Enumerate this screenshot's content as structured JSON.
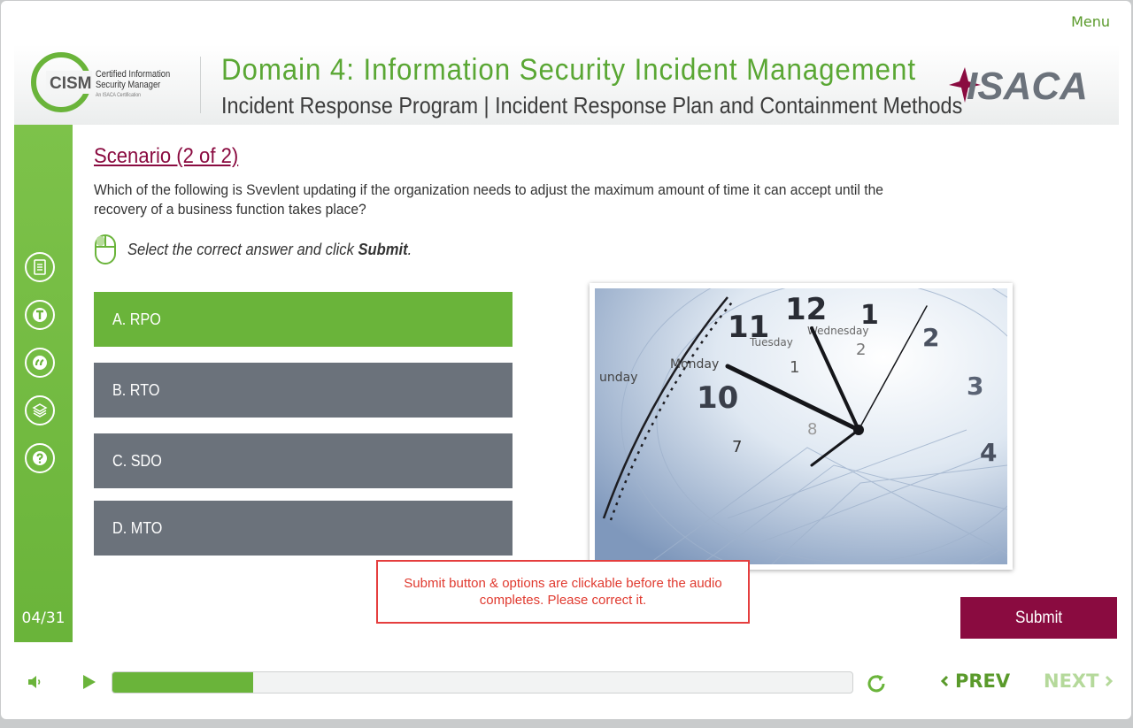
{
  "menu": {
    "label": "Menu"
  },
  "header": {
    "cism_mark": "CISM",
    "cism_line1": "Certified Information",
    "cism_line2": "Security Manager",
    "cism_tagline": "An ISACA Certification",
    "domain_title": "Domain 4: Information Security Incident Management",
    "subtitle": "Incident Response Program | Incident Response Plan and Containment Methods",
    "brand": "ISACA"
  },
  "sidebar": {
    "icons": [
      "notes-icon",
      "transcript-icon",
      "quote-icon",
      "layers-icon",
      "help-icon"
    ],
    "page": "04/31"
  },
  "question": {
    "heading": "Scenario (2 of 2)",
    "text": "Which of the following is Svevlent updating if the organization needs to adjust the maximum amount of time it can accept until the recovery of a business function takes place?",
    "instruction_prefix": "Select the correct answer and click ",
    "instruction_bold": "Submit",
    "instruction_suffix": "."
  },
  "options": [
    {
      "label": "A. RPO",
      "selected": true
    },
    {
      "label": "B. RTO",
      "selected": false
    },
    {
      "label": "C. SDO",
      "selected": false
    },
    {
      "label": "D. MTO",
      "selected": false
    }
  ],
  "review_note": "Submit button & options are clickable before the audio completes. Please correct it.",
  "submit_label": "Submit",
  "player": {
    "progress": 0.19,
    "prev_label": "PREV",
    "next_label": "NEXT"
  },
  "colors": {
    "accent_green": "#6ab43a",
    "title_green": "#5aa734",
    "maroon": "#8a0b40",
    "option_gray": "#6b727b",
    "note_red": "#e03a2f"
  }
}
